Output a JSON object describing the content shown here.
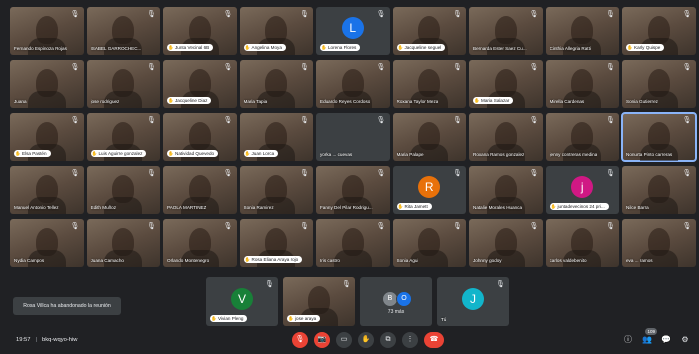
{
  "tiles": [
    {
      "name": "Fernando Espinoza Rojas",
      "type": "video",
      "pill": false
    },
    {
      "name": "ISABEL GARROCHEC...",
      "type": "video",
      "pill": false
    },
    {
      "name": "Junta Vecinal 6B",
      "type": "video",
      "pill": true
    },
    {
      "name": "Angelina Moya",
      "type": "video",
      "pill": true
    },
    {
      "name": "Lorena Flores",
      "type": "avatar",
      "pill": true,
      "initial": "L",
      "color": "#1a73e8"
    },
    {
      "name": "Jacqueline seguel",
      "type": "video",
      "pill": true
    },
    {
      "name": "Bernarda Ester Saez Cu...",
      "type": "video",
      "pill": false
    },
    {
      "name": "Cinthia Allegria Ratti",
      "type": "video",
      "pill": false
    },
    {
      "name": "Karly Quispe",
      "type": "video",
      "pill": true
    },
    {
      "name": "Juana",
      "type": "video",
      "pill": false
    },
    {
      "name": "jose rodriguez",
      "type": "video",
      "pill": false
    },
    {
      "name": "Jacqueline Diaz",
      "type": "video",
      "pill": true
    },
    {
      "name": "Maria Tapia",
      "type": "video",
      "pill": false
    },
    {
      "name": "Eduardo Reyes Cordoso",
      "type": "video",
      "pill": false
    },
    {
      "name": "Roxana Taylor Meza",
      "type": "video",
      "pill": false
    },
    {
      "name": "Maria Salazar",
      "type": "video",
      "pill": true
    },
    {
      "name": "Mirella Cardenas",
      "type": "video",
      "pill": false
    },
    {
      "name": "Sonia Gutierrez",
      "type": "video",
      "pill": false
    },
    {
      "name": "Elsa Pastén",
      "type": "video",
      "pill": true
    },
    {
      "name": "Luis Aguirre gonzalez",
      "type": "video",
      "pill": true
    },
    {
      "name": "Natividad Quevedo",
      "type": "video",
      "pill": true
    },
    {
      "name": "Juan Lorca",
      "type": "video",
      "pill": true
    },
    {
      "name": "yorka ... cuevas",
      "type": "avatar-dark",
      "pill": false
    },
    {
      "name": "Maria Palape",
      "type": "video",
      "pill": false
    },
    {
      "name": "Roxana Ramos gonzalez",
      "type": "video",
      "pill": false
    },
    {
      "name": "jenny contreras medina",
      "type": "video",
      "pill": false
    },
    {
      "name": "Nonurta Pinto carreras",
      "type": "video",
      "pill": false,
      "active": true
    },
    {
      "name": "Manuel Antonio Tellez",
      "type": "video",
      "pill": false
    },
    {
      "name": "Edith Muñoz",
      "type": "video",
      "pill": false
    },
    {
      "name": "PAOLA MARTINEZ",
      "type": "video",
      "pill": false
    },
    {
      "name": "Sonia Ramirez",
      "type": "video",
      "pill": false
    },
    {
      "name": "Fanny Del Pilar Rodrigu...",
      "type": "video",
      "pill": false
    },
    {
      "name": "Rita Jamett",
      "type": "avatar",
      "pill": true,
      "initial": "R",
      "color": "#e8710a"
    },
    {
      "name": "Natalie Morales Huanca",
      "type": "video",
      "pill": false
    },
    {
      "name": "juntadevecinos 24 pri...",
      "type": "avatar",
      "pill": true,
      "initial": "j",
      "color": "#d01884"
    },
    {
      "name": "Nilce Barra",
      "type": "video",
      "pill": false
    },
    {
      "name": "Nydia Campos",
      "type": "video",
      "pill": false
    },
    {
      "name": "Juana Camacho",
      "type": "video",
      "pill": false
    },
    {
      "name": "Orlando Montenegro",
      "type": "video",
      "pill": false
    },
    {
      "name": "Rosa Eliana Araya rojo",
      "type": "video",
      "pill": true
    },
    {
      "name": "Iris castro",
      "type": "video",
      "pill": false
    },
    {
      "name": "Sonia Agui",
      "type": "video",
      "pill": false
    },
    {
      "name": "Johnny godoy",
      "type": "video",
      "pill": false
    },
    {
      "name": "carlos valdebenito",
      "type": "video",
      "pill": false
    },
    {
      "name": "eva ... ramos",
      "type": "video",
      "pill": false
    }
  ],
  "bottom_tiles": {
    "vivian": {
      "name": "Vivian Pleng",
      "initial": "V",
      "color": "#188038"
    },
    "jose": {
      "name": "jose araya"
    },
    "more": {
      "a": "B",
      "a_color": "#80868b",
      "b": "O",
      "b_color": "#1a73e8",
      "count": "73 más"
    },
    "you": {
      "name": "Tú",
      "initial": "J",
      "color": "#12b5cb"
    }
  },
  "toast": "Rosa Villca ha abandonado la reunión",
  "meeting": {
    "time": "19:57",
    "code": "bkq-wqyo-hiw"
  },
  "controls": {
    "mic": "🎙",
    "cam": "📷",
    "captions": "▭",
    "hand": "✋",
    "present": "⧉",
    "more": "⋮",
    "end": "☎"
  },
  "right": {
    "info": "ⓘ",
    "people": "👥",
    "people_count": "109",
    "chat": "💬",
    "activities": "⚙"
  }
}
